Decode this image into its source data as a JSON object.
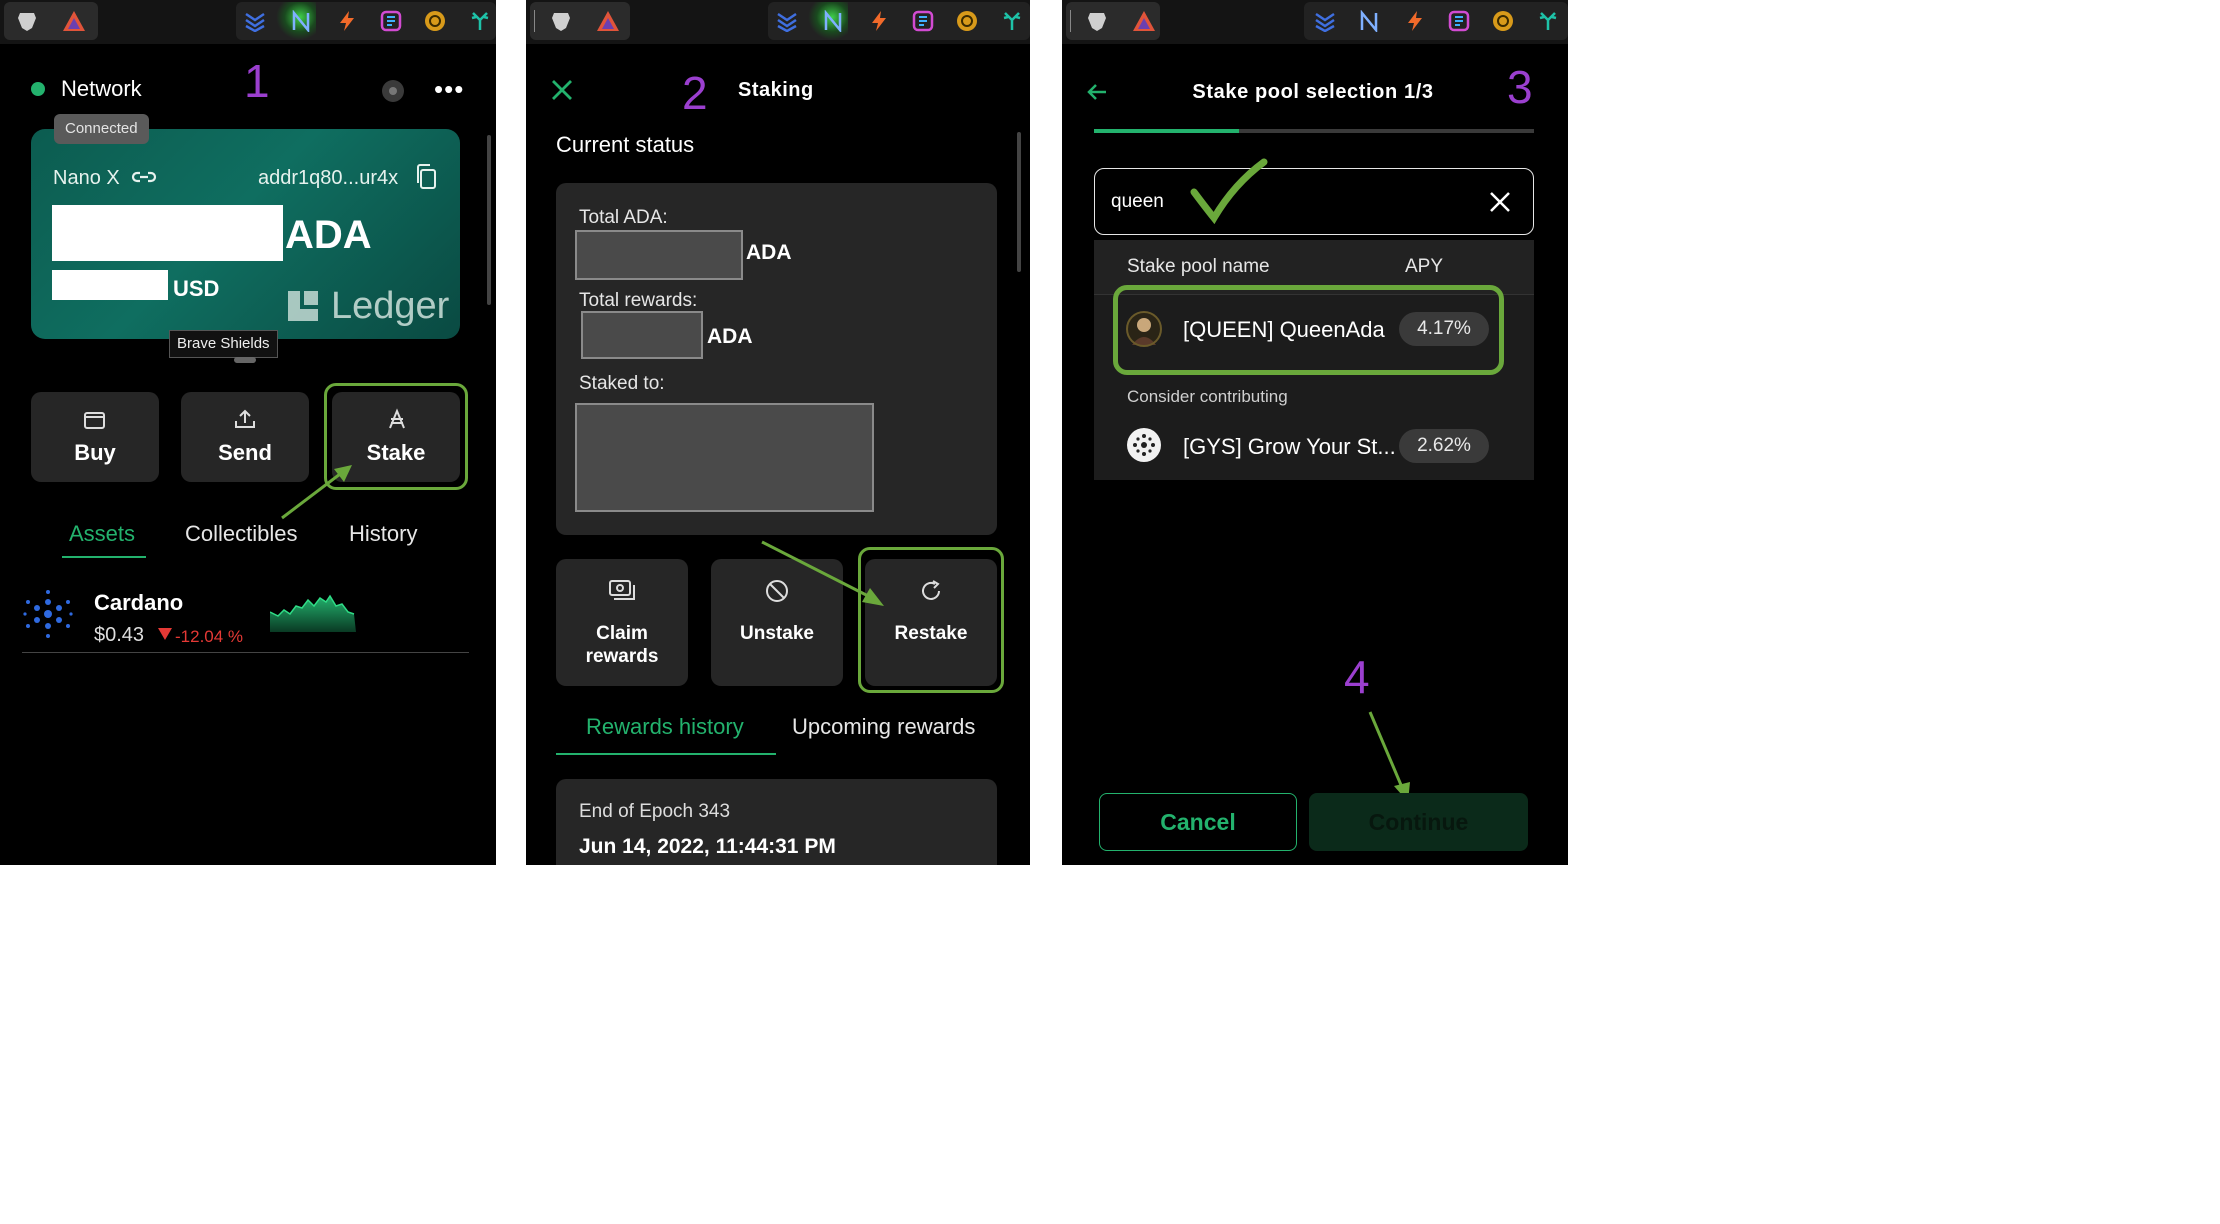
{
  "steps": [
    "1",
    "2",
    "3",
    "4"
  ],
  "panel1": {
    "network_label": "Network",
    "connected_badge": "Connected",
    "device_name": "Nano X",
    "address": "addr1q80...ur4x",
    "currency_main": "ADA",
    "currency_fiat": "USD",
    "brand": "Ledger",
    "tooltip": "Brave Shields",
    "actions": {
      "buy": "Buy",
      "send": "Send",
      "stake": "Stake"
    },
    "tabs": {
      "assets": "Assets",
      "collectibles": "Collectibles",
      "history": "History"
    },
    "asset": {
      "name": "Cardano",
      "price": "$0.43",
      "change": "-12.04 %"
    },
    "colors": {
      "accent": "#23b26d",
      "negative": "#e53935",
      "highlight": "#6aa83b"
    }
  },
  "panel2": {
    "title": "Staking",
    "section_title": "Current status",
    "total_ada_label": "Total ADA:",
    "total_ada_unit": "ADA",
    "total_rewards_label": "Total rewards:",
    "total_rewards_unit": "ADA",
    "staked_to_label": "Staked to:",
    "actions": {
      "claim_line1": "Claim",
      "claim_line2": "rewards",
      "unstake": "Unstake",
      "restake": "Restake"
    },
    "tabs": {
      "rewards_history": "Rewards history",
      "upcoming": "Upcoming rewards"
    },
    "epoch_label": "End of Epoch 343",
    "epoch_date": "Jun 14, 2022, 11:44:31 PM"
  },
  "panel3": {
    "title": "Stake pool selection 1/3",
    "progress": 0.33,
    "search_value": "queen",
    "col_name": "Stake pool name",
    "col_apy": "APY",
    "pools": [
      {
        "name": "[QUEEN] QueenAda",
        "apy": "4.17%"
      }
    ],
    "consider_label": "Consider contributing",
    "contrib_pools": [
      {
        "name": "[GYS] Grow Your St...",
        "apy": "2.62%"
      }
    ],
    "cancel": "Cancel",
    "continue": "Continue"
  }
}
